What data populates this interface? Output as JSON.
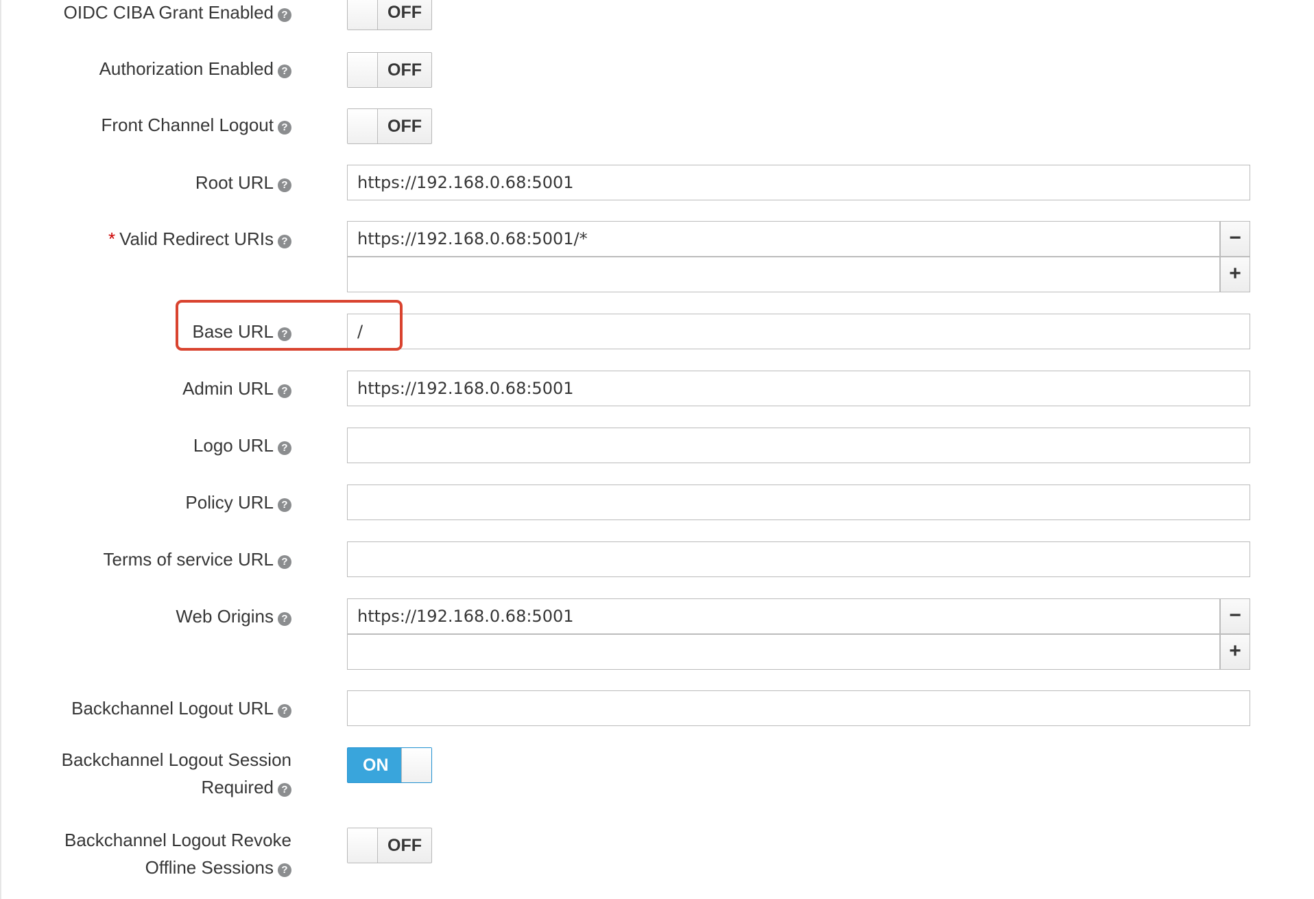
{
  "fields": {
    "oidc_ciba": {
      "label": "OIDC CIBA Grant Enabled",
      "state": "OFF"
    },
    "authorization": {
      "label": "Authorization Enabled",
      "state": "OFF"
    },
    "front_channel": {
      "label": "Front Channel Logout",
      "state": "OFF"
    },
    "root_url": {
      "label": "Root URL",
      "value": "https://192.168.0.68:5001"
    },
    "valid_redirect": {
      "required_mark": "*",
      "label": "Valid Redirect URIs",
      "values": [
        "https://192.168.0.68:5001/*",
        ""
      ],
      "remove_label": "−",
      "add_label": "+"
    },
    "base_url": {
      "label": "Base URL",
      "value": "/"
    },
    "admin_url": {
      "label": "Admin URL",
      "value": "https://192.168.0.68:5001"
    },
    "logo_url": {
      "label": "Logo URL",
      "value": ""
    },
    "policy_url": {
      "label": "Policy URL",
      "value": ""
    },
    "tos_url": {
      "label": "Terms of service URL",
      "value": ""
    },
    "web_origins": {
      "label": "Web Origins",
      "values": [
        "https://192.168.0.68:5001",
        ""
      ],
      "remove_label": "−",
      "add_label": "+"
    },
    "backchannel_url": {
      "label": "Backchannel Logout URL",
      "value": ""
    },
    "backchannel_session": {
      "label_line1": "Backchannel Logout Session",
      "label_line2": "Required",
      "state": "ON"
    },
    "backchannel_revoke": {
      "label_line1": "Backchannel Logout Revoke",
      "label_line2": "Offline Sessions",
      "state": "OFF"
    }
  },
  "help_icon": "question-circle-icon",
  "colors": {
    "toggle_on": "#39a5dc",
    "highlight_box": "#d9432f",
    "required": "#cc0000"
  }
}
